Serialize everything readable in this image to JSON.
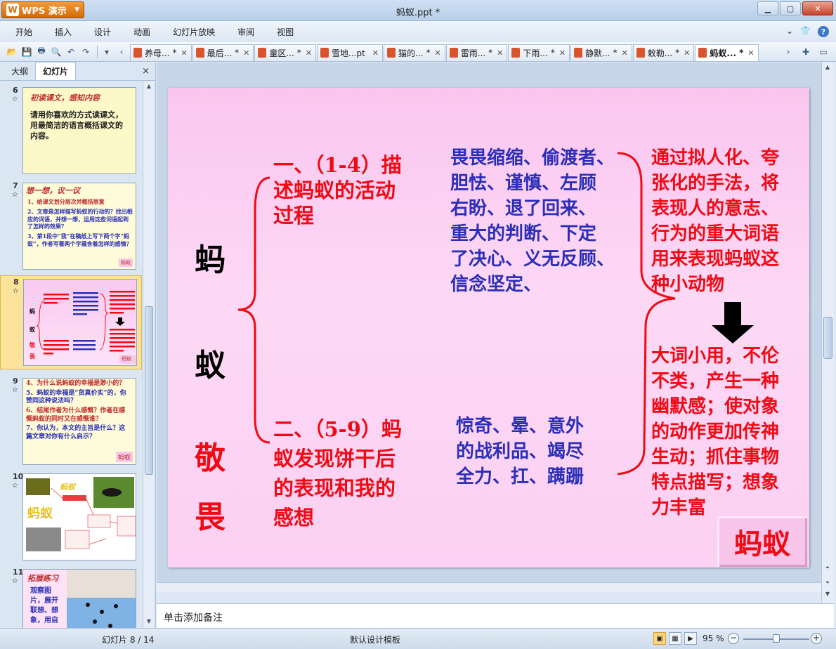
{
  "app": {
    "brand": "WPS 演示",
    "window_title": "蚂蚁.ppt *",
    "window_controls": [
      "minimize",
      "maximize",
      "close"
    ]
  },
  "menu": {
    "items": [
      "开始",
      "插入",
      "设计",
      "动画",
      "幻灯片放映",
      "审阅",
      "视图"
    ]
  },
  "tabs": [
    {
      "label": "养母...",
      "modified": "*"
    },
    {
      "label": "最后...",
      "modified": "*"
    },
    {
      "label": "童区...",
      "modified": "*"
    },
    {
      "label": "雪地...pt",
      "modified": ""
    },
    {
      "label": "猫的...",
      "modified": "*"
    },
    {
      "label": "雷雨...",
      "modified": "*"
    },
    {
      "label": "下雨...",
      "modified": "*"
    },
    {
      "label": "静默...",
      "modified": "*"
    },
    {
      "label": "敕勒...",
      "modified": "*"
    },
    {
      "label": "蚂蚁...",
      "modified": "*",
      "active": true
    }
  ],
  "left_panel": {
    "tab_outline": "大纲",
    "tab_slides": "幻灯片",
    "close": "×",
    "thumbs": [
      {
        "num": "6",
        "title": "初读课文，感知内容",
        "body": "请用你喜欢的方式读课文，用最简洁的语言概括课文的内容。"
      },
      {
        "num": "7",
        "title": "想一想，议一议",
        "lines": [
          "1、给课文划分层次并概括层意",
          "2、文章是怎样描写蚂蚁的行动的？找出相应的词语，并想一想，运用这些词语起到了怎样的效果？",
          "3、第1段中“我”在稿纸上写下两个字“蚂蚁”，作者写著两个字蕴含着怎样的感情？"
        ],
        "tag": "蚂蚁"
      },
      {
        "num": "8",
        "tag": "蚂蚁"
      },
      {
        "num": "9",
        "lines": [
          "4、为什么说蚂蚁的幸福是渺小的？",
          "5、蚂蚁的幸福是“货真价实”的，你赞同这种说法吗？",
          "6、结尾作者为什么感慨？作者在感慨蚂蚁的同时又在感慨谁？",
          "7、你认为，本文的主旨是什么？这篇文章对你有什么启示？"
        ],
        "tag": "蚂蚁"
      },
      {
        "num": "10",
        "title": "蚂蚁"
      },
      {
        "num": "11",
        "title": "拓展练习",
        "body": "观察图片，展开联想、想象，用自"
      }
    ]
  },
  "slide": {
    "vertical_chars": [
      "蚂",
      "蚁",
      "敬",
      "畏"
    ],
    "part1_lines": [
      "一、（1-4）描",
      "述蚂蚁的活动",
      "过程"
    ],
    "part1_words_lines": [
      "畏畏缩缩、偷渡者、",
      "胆怯、谨慎、左顾",
      "右盼、退了回来、",
      "重大的判断、下定",
      "了决心、义无反顾、",
      "信念坚定、"
    ],
    "part2_lines": [
      "二、（5-9）蚂",
      "蚁发现饼干后",
      "的表现和我的",
      "感想"
    ],
    "part2_words_lines": [
      "惊奇、晕、意外",
      "的战利品、竭尽",
      "全力、扛、蹒跚"
    ],
    "right_top_lines": [
      "通过拟人化、夸",
      "张化的手法，将",
      "表现人的意志、",
      "行为的重大词语",
      "用来表现蚂蚁这",
      "种小动物"
    ],
    "right_bottom_lines": [
      "大词小用，不伦",
      "不类，产生一种",
      "幽默感；使对象",
      "的动作更加传神",
      "生动；抓住事物",
      "特点描写；想象",
      "力丰富"
    ],
    "badge": "蚂蚁",
    "colors": {
      "red": "#f00a14",
      "blue": "#2b2fb8",
      "background": "#fbd0f2"
    }
  },
  "notes": {
    "placeholder": "单击添加备注"
  },
  "status": {
    "slide_indicator": "幻灯片 8 / 14",
    "template": "默认设计模板",
    "zoom": "95 %",
    "zoom_level": 0.5
  }
}
